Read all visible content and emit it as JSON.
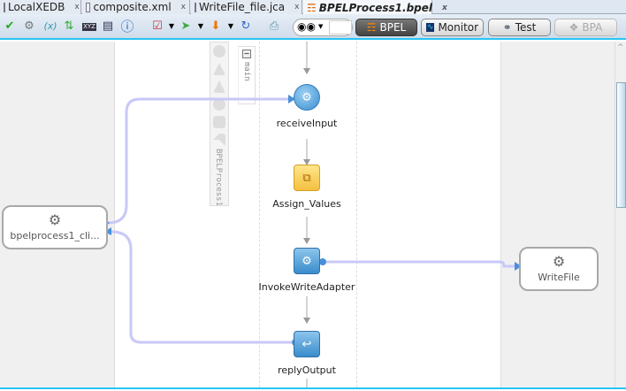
{
  "tabs": [
    {
      "label": "LocalXEDB",
      "close": "x"
    },
    {
      "label": "composite.xml",
      "close": "x"
    },
    {
      "label": "WriteFile_file.jca",
      "close": "x"
    },
    {
      "label": "BPELProcess1.bpel",
      "close": "x",
      "active": true
    }
  ],
  "toolbar": {
    "icons": [
      "validate-icon",
      "settings-icon",
      "variables-icon",
      "refresh-icon",
      "xyz-icon",
      "xslt-icon",
      "info-icon",
      "checklist-icon",
      "deploy-icon",
      "install-icon",
      "sync-icon",
      "print-icon",
      "search-icon"
    ],
    "search_value": "",
    "modes": [
      {
        "label": "BPEL",
        "selected": true
      },
      {
        "label": "Monitor"
      },
      {
        "label": "Test"
      },
      {
        "label": "BPA",
        "disabled": true
      }
    ]
  },
  "palette": {
    "label": "BPELProcess1"
  },
  "scope": {
    "label": "main"
  },
  "activities": [
    {
      "label": "receiveInput",
      "type": "receive"
    },
    {
      "label": "Assign_Values",
      "type": "assign"
    },
    {
      "label": "InvokeWriteAdapter",
      "type": "invoke"
    },
    {
      "label": "replyOutput",
      "type": "reply"
    }
  ],
  "services": {
    "left": "bpelprocess1_cli...",
    "right": "WriteFile"
  },
  "colors": {
    "accent": "#29c4f4",
    "link": "#c8c8f8",
    "arrow": "#4a90d9"
  }
}
